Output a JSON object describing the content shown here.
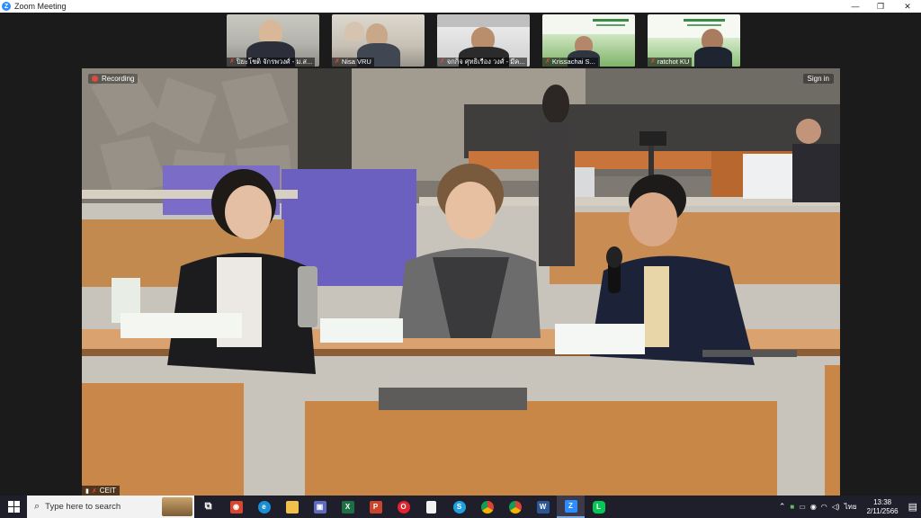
{
  "window": {
    "title": "Zoom Meeting",
    "controls": {
      "minimize": "—",
      "restore": "❐",
      "close": "✕"
    }
  },
  "participants": [
    {
      "name": "ปิยะโชติ จักรพวงศ์ - ม.ส...",
      "muted": true
    },
    {
      "name": "Nisa VRU",
      "muted": true
    },
    {
      "name": "จกกิจ ศุทธิเรือง วงศ์ - มีค...",
      "muted": true
    },
    {
      "name": "Krissachai S...",
      "muted": true
    },
    {
      "name": "ratchot KU",
      "muted": true
    }
  ],
  "main_video": {
    "recording_label": "Recording",
    "sign_in_label": "Sign in",
    "speaker_name": "CEIT"
  },
  "taskbar": {
    "search_placeholder": "Type here to search",
    "apps": [
      "task-view",
      "file-explorer",
      "edge",
      "folder",
      "store",
      "excel",
      "powerpoint",
      "opera",
      "file",
      "skype",
      "chrome",
      "chrome-2",
      "word",
      "zoom",
      "line"
    ],
    "tray": {
      "language": "ไทย",
      "time": "13:38",
      "date": "2/11/2566"
    }
  },
  "colors": {
    "zoom_blue": "#2d8cff",
    "record_red": "#e5483b",
    "taskbar": "#1f1f2b"
  }
}
